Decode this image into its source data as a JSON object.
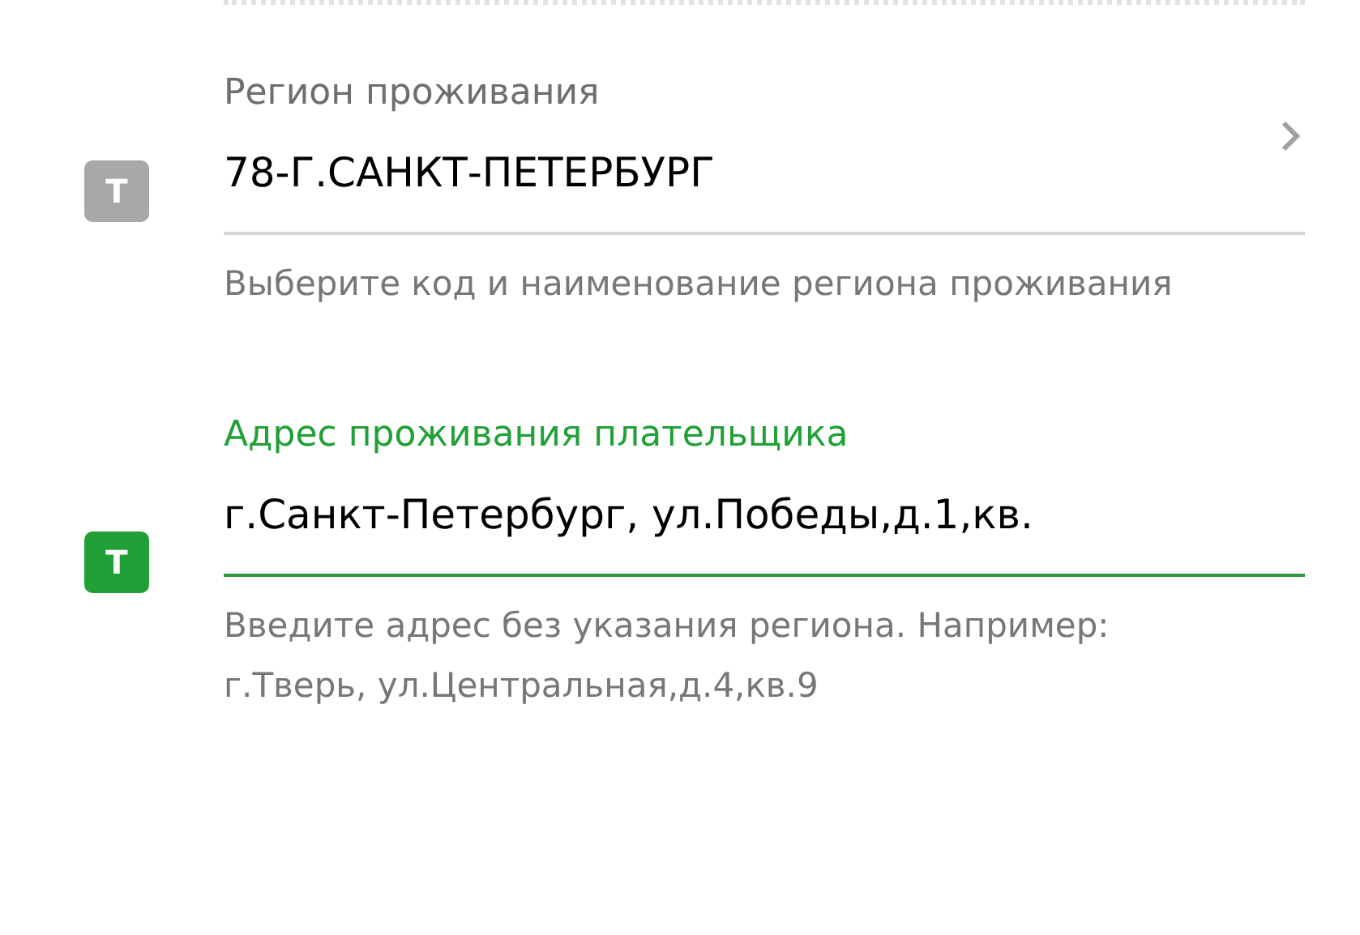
{
  "fields": [
    {
      "kind": "select",
      "badge": "Т",
      "focused": false,
      "label": "Регион проживания",
      "value": "78-Г.САНКТ-ПЕТЕРБУРГ",
      "hint": "Выберите код и наименование региона проживания"
    },
    {
      "kind": "text",
      "badge": "Т",
      "focused": true,
      "label": "Адрес проживания плательщика",
      "value": "г.Санкт-Петербург, ул.Победы,д.1,кв.",
      "hint": "Введите адрес без указания региона. Например: г.Тверь, ул.Центральная,д.4,кв.9"
    }
  ]
}
